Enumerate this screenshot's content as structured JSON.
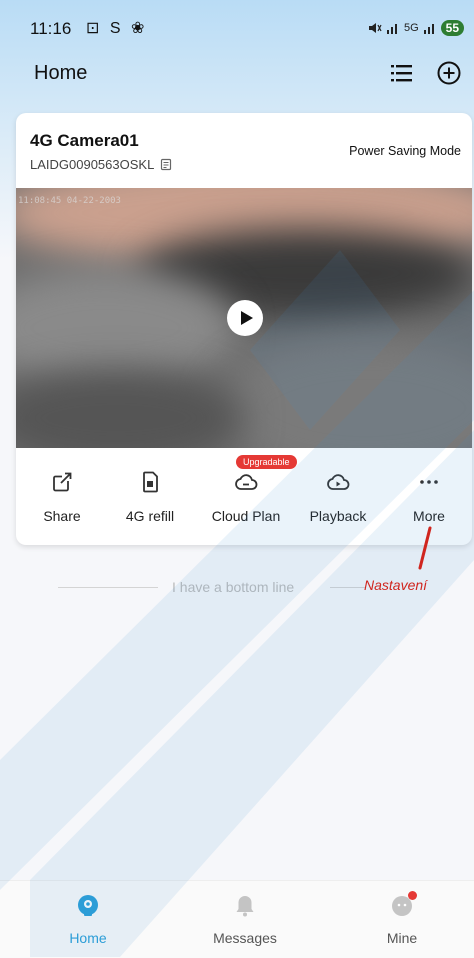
{
  "status_bar": {
    "time": "11:16",
    "left_icons": "⊡ S ❀",
    "signal_text": "5G",
    "battery": "55"
  },
  "header": {
    "title": "Home"
  },
  "device_card": {
    "name": "4G Camera01",
    "serial": "LAIDG0090563OSKL",
    "mode": "Power Saving Mode",
    "video_timestamp": "11:08:45 04-22-2003",
    "actions": [
      {
        "label": "Share",
        "icon": "share-icon"
      },
      {
        "label": "4G refill",
        "icon": "sim-card-icon"
      },
      {
        "label": "Cloud Plan",
        "icon": "cloud-minus-icon",
        "badge": "Upgradable"
      },
      {
        "label": "Playback",
        "icon": "cloud-play-icon"
      },
      {
        "label": "More",
        "icon": "more-dots-icon"
      }
    ]
  },
  "bottom_line_text": "I have a bottom line",
  "annotation": {
    "text": "Nastavení",
    "color": "#d0251e"
  },
  "nav": {
    "tabs": [
      {
        "label": "Home",
        "active": true
      },
      {
        "label": "Messages",
        "active": false
      },
      {
        "label": "Mine",
        "active": false
      }
    ]
  },
  "colors": {
    "accent": "#2a9fd8",
    "badge": "#e53935",
    "battery": "#2e7d32"
  }
}
